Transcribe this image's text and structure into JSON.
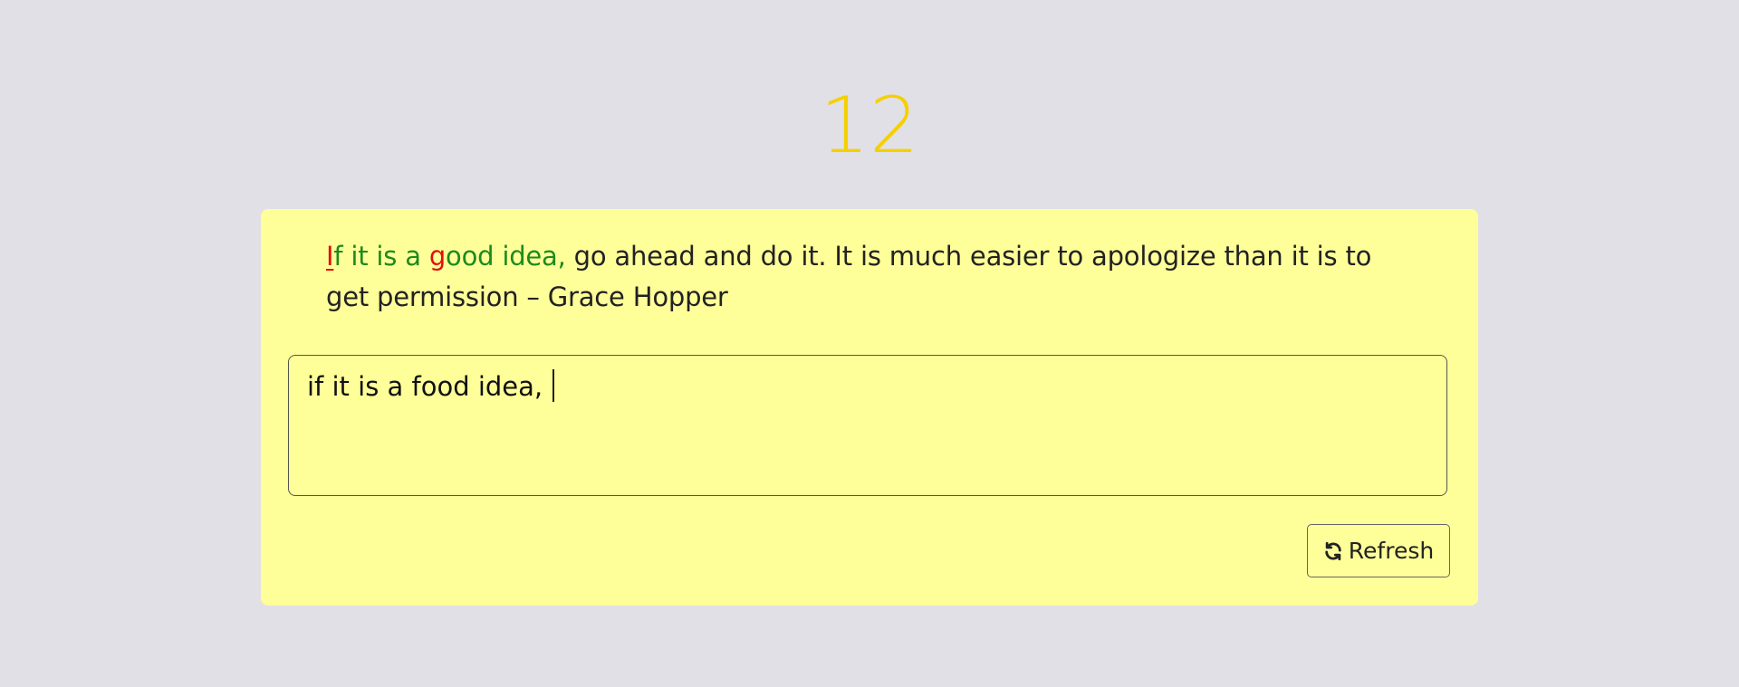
{
  "timer": {
    "value": "12"
  },
  "quote": {
    "segments": [
      {
        "text": "I",
        "state": "error-current"
      },
      {
        "text": "f it is a ",
        "state": "correct"
      },
      {
        "text": "g",
        "state": "error"
      },
      {
        "text": "ood idea,",
        "state": "correct"
      },
      {
        "text": " go ahead and do it. It is much easier to apologize than it is to get permission – Grace Hopper",
        "state": "pending"
      }
    ]
  },
  "input": {
    "value": "if it is a food idea, "
  },
  "refresh": {
    "label": "Refresh",
    "icon": "refresh-icon"
  },
  "colors": {
    "background": "#e1e0e6",
    "card": "#ffff99",
    "timer": "#f5d000",
    "correct": "#1e8a1e",
    "error": "#e01010",
    "text": "#222222"
  }
}
